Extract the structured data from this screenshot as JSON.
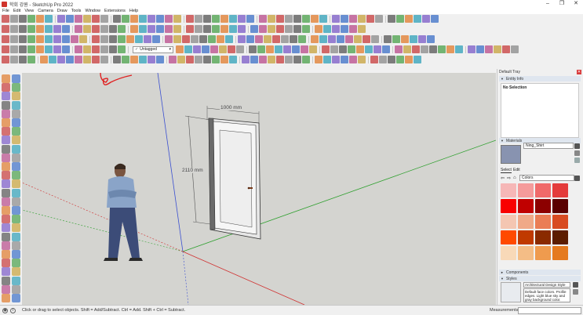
{
  "window": {
    "title": "학회 강원 - SketchUp Pro 2022",
    "minimize": "–",
    "restore": "❐",
    "close": "✕"
  },
  "menu": [
    "File",
    "Edit",
    "View",
    "Camera",
    "Draw",
    "Tools",
    "Window",
    "Extensions",
    "Help"
  ],
  "toolbar": {
    "tag_dropdown_value": "Untagged",
    "tag_check": "✓",
    "tag_arrow": "▾"
  },
  "viewport": {
    "dimension_width": "1000 mm",
    "dimension_height": "2110 mm"
  },
  "tray": {
    "title": "Default Tray",
    "close": "✕",
    "entity_info": {
      "header": "Entity Info",
      "selection": "No Selection"
    },
    "materials": {
      "header": "Materials",
      "material_name": "Ning_Shirt",
      "tab_select": "Select",
      "tab_edit": "Edit",
      "collection": "Colors",
      "swatches": [
        "#f6b7b7",
        "#f59b9b",
        "#f06a6a",
        "#e43b3b",
        "#f80000",
        "#c00000",
        "#8c0000",
        "#5a0000",
        "#f4c6b2",
        "#f0a988",
        "#ea7d55",
        "#d84b21",
        "#ff4a00",
        "#c03a00",
        "#8a2a00",
        "#5c1d00",
        "#f8d9b8",
        "#f4bd86",
        "#ef9b4e",
        "#e57a1f"
      ]
    },
    "components": {
      "header": "Components"
    },
    "styles": {
      "header": "Styles",
      "style_name": "Architectural Design Style",
      "style_description": "Default face colors. Profile edges. Light blue sky and gray background color."
    }
  },
  "statusbar": {
    "hint": "Click or drag to select objects. Shift = Add/Subtract. Ctrl = Add. Shift + Ctrl = Subtract.",
    "measurements_label": "Measurements",
    "info_icon": "i",
    "geo_icon": "◉"
  },
  "accent_colors": {
    "title_red": "#d0342c",
    "annotation_red": "#e02020",
    "axis_blue": "#3a4fd0",
    "axis_green": "#2fa02f",
    "axis_red": "#d03030"
  }
}
